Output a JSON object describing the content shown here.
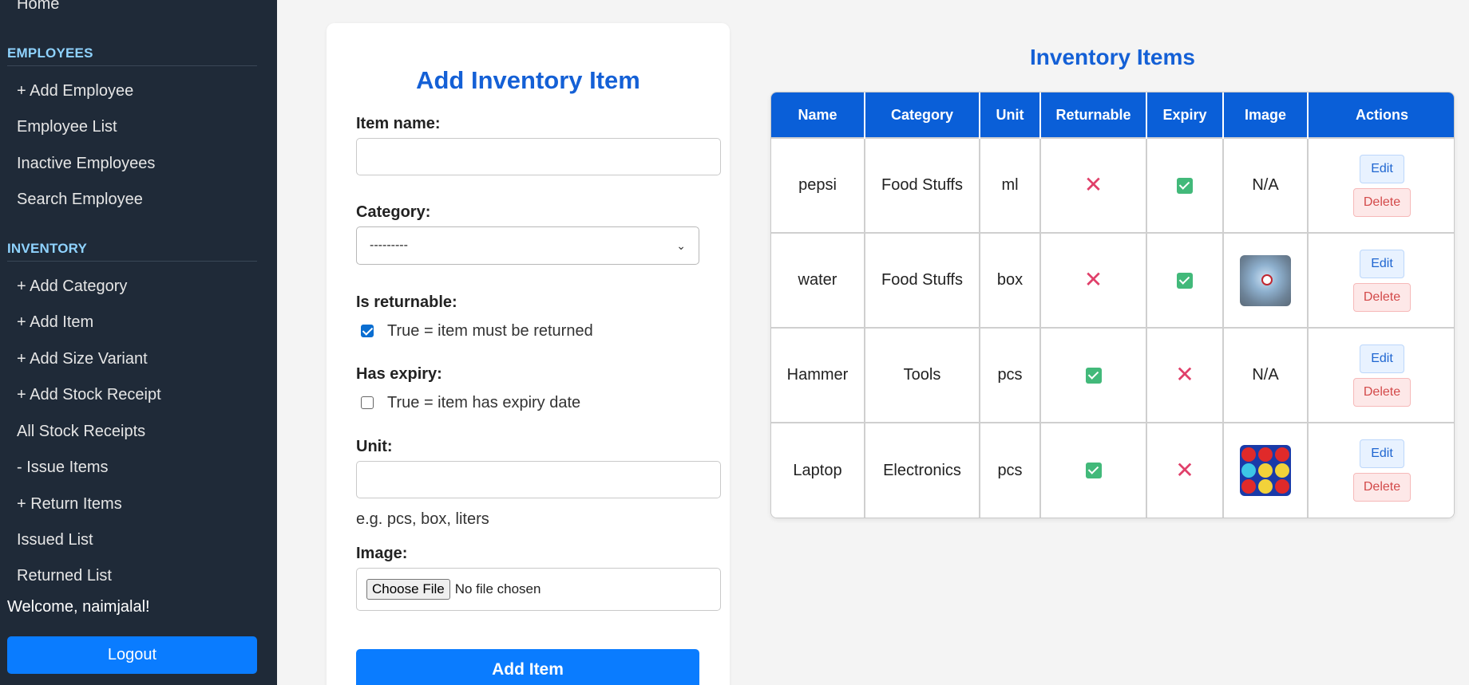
{
  "sidebar": {
    "home_link": "Home",
    "employees_heading": "EMPLOYEES",
    "employee_links": [
      "+ Add Employee",
      "Employee List",
      "Inactive Employees",
      "Search Employee"
    ],
    "inventory_heading": "INVENTORY",
    "inventory_links": [
      "+ Add Category",
      "+ Add Item",
      "+ Add Size Variant",
      "+ Add Stock Receipt",
      "All Stock Receipts",
      "- Issue Items",
      "+ Return Items",
      "Issued List",
      "Returned List"
    ],
    "welcome": "Welcome, naimjalal!",
    "logout": "Logout"
  },
  "form": {
    "title": "Add Inventory Item",
    "item_name_label": "Item name:",
    "item_name_value": "",
    "category_label": "Category:",
    "category_selected": "---------",
    "returnable_label": "Is returnable:",
    "returnable_checked": true,
    "returnable_text": "True = item must be returned",
    "expiry_label": "Has expiry:",
    "expiry_checked": false,
    "expiry_text": "True = item has expiry date",
    "unit_label": "Unit:",
    "unit_value": "",
    "unit_hint": "e.g. pcs, box, liters",
    "image_label": "Image:",
    "file_button": "Choose File",
    "file_status": "No file chosen",
    "submit": "Add Item"
  },
  "table": {
    "title": "Inventory Items",
    "headers": [
      "Name",
      "Category",
      "Unit",
      "Returnable",
      "Expiry",
      "Image",
      "Actions"
    ],
    "rows": [
      {
        "name": "pepsi",
        "category": "Food Stuffs",
        "unit": "ml",
        "returnable": false,
        "expiry": true,
        "image": "N/A",
        "image_icon": "none"
      },
      {
        "name": "water",
        "category": "Food Stuffs",
        "unit": "box",
        "returnable": false,
        "expiry": true,
        "image": "",
        "image_icon": "chip-thumbnail"
      },
      {
        "name": "Hammer",
        "category": "Tools",
        "unit": "pcs",
        "returnable": true,
        "expiry": false,
        "image": "N/A",
        "image_icon": "none"
      },
      {
        "name": "Laptop",
        "category": "Electronics",
        "unit": "pcs",
        "returnable": true,
        "expiry": false,
        "image": "",
        "image_icon": "colored-balls-thumbnail"
      }
    ],
    "edit_label": "Edit",
    "delete_label": "Delete"
  },
  "colors": {
    "sidebar_bg": "#1f2a38",
    "accent_blue": "#0a7cff",
    "title_blue": "#1460d6",
    "table_header": "#0a5fd8",
    "false_mark": "#e0406a",
    "true_mark": "#42b97a"
  }
}
